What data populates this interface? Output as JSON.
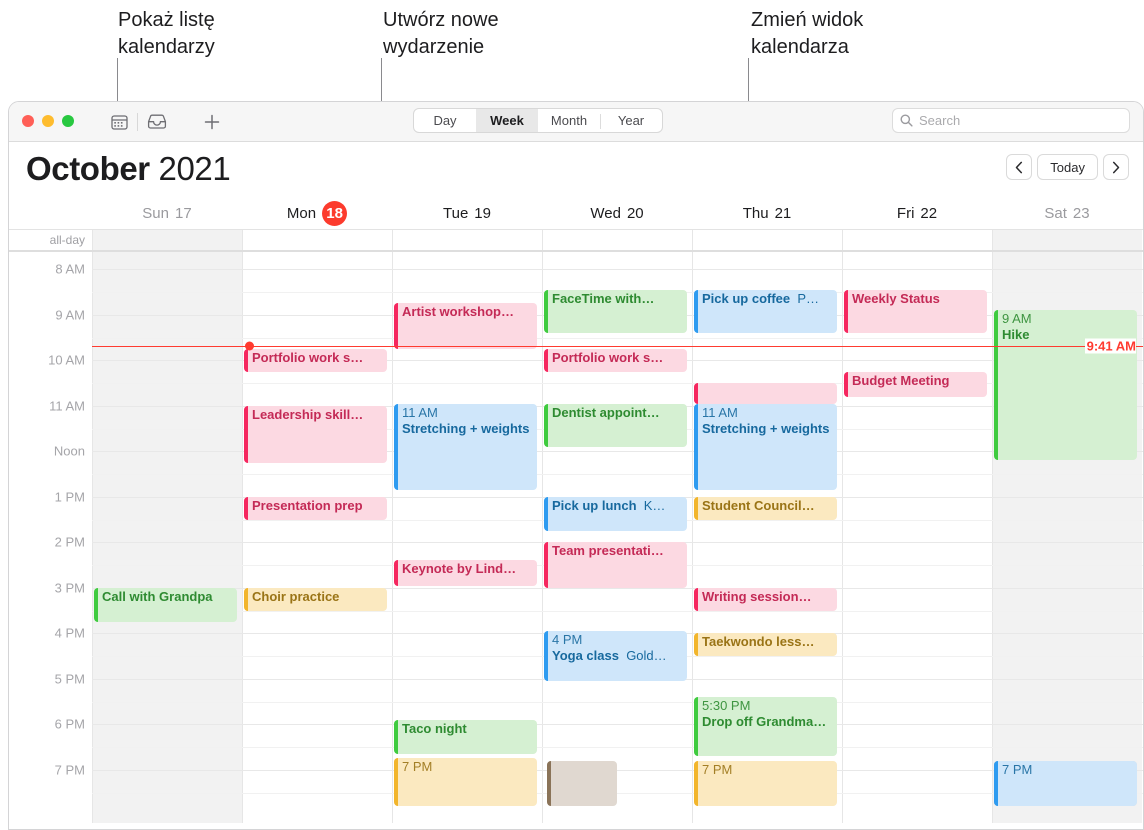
{
  "callouts": [
    {
      "id": "show-calendar-list",
      "text": "Pokaż listę\nkalendarzy"
    },
    {
      "id": "create-new-event",
      "text": "Utwórz nowe\nwydarzenie"
    },
    {
      "id": "change-calendar-view",
      "text": "Zmień widok\nkalendarza"
    }
  ],
  "toolbar": {
    "icons": [
      {
        "name": "calendar-sidebar-icon"
      },
      {
        "name": "inbox-icon"
      },
      {
        "name": "plus-icon"
      }
    ],
    "view_segments": [
      {
        "label": "Day",
        "active": false
      },
      {
        "label": "Week",
        "active": true
      },
      {
        "label": "Month",
        "active": false
      },
      {
        "label": "Year",
        "active": false
      }
    ],
    "search": {
      "placeholder": "Search",
      "value": ""
    }
  },
  "header": {
    "month": "October",
    "year": "2021",
    "nav": {
      "prev": "‹",
      "today": "Today",
      "next": "›"
    }
  },
  "grid": {
    "allday_label": "all-day",
    "days": [
      {
        "weekday": "Sun",
        "daynum": "17",
        "dim": true,
        "today": false,
        "weekend": true
      },
      {
        "weekday": "Mon",
        "daynum": "18",
        "dim": false,
        "today": true,
        "weekend": false
      },
      {
        "weekday": "Tue",
        "daynum": "19",
        "dim": false,
        "today": false,
        "weekend": false
      },
      {
        "weekday": "Wed",
        "daynum": "20",
        "dim": false,
        "today": false,
        "weekend": false
      },
      {
        "weekday": "Thu",
        "daynum": "21",
        "dim": false,
        "today": false,
        "weekend": false
      },
      {
        "weekday": "Fri",
        "daynum": "22",
        "dim": false,
        "today": false,
        "weekend": false
      },
      {
        "weekday": "Sat",
        "daynum": "23",
        "dim": true,
        "today": false,
        "weekend": true
      }
    ],
    "hours": [
      "8 AM",
      "9 AM",
      "10 AM",
      "11 AM",
      "Noon",
      "1 PM",
      "2 PM",
      "3 PM",
      "4 PM",
      "5 PM",
      "6 PM",
      "7 PM"
    ],
    "now": {
      "label": "9:41 AM",
      "color": "#ff3b30"
    }
  },
  "events": [
    {
      "day": 0,
      "title": "Call with Grandpa",
      "time": "",
      "location": "",
      "color": "green",
      "start": 15.0,
      "end": 15.75,
      "wrap": false
    },
    {
      "day": 1,
      "title": "Portfolio work s…",
      "time": "",
      "location": "",
      "color": "pink",
      "start": 9.75,
      "end": 10.25,
      "wrap": false
    },
    {
      "day": 1,
      "title": "Leadership skill…",
      "time": "",
      "location": "",
      "color": "pink",
      "start": 11.0,
      "end": 12.25,
      "wrap": false
    },
    {
      "day": 1,
      "title": "Presentation prep",
      "time": "",
      "location": "",
      "color": "pink",
      "start": 13.0,
      "end": 13.5,
      "wrap": false
    },
    {
      "day": 1,
      "title": "Choir practice",
      "time": "",
      "location": "",
      "color": "yellow",
      "start": 15.0,
      "end": 15.5,
      "wrap": false
    },
    {
      "day": 2,
      "title": "Artist workshop…",
      "time": "",
      "location": "",
      "color": "pink",
      "start": 8.75,
      "end": 9.75,
      "wrap": false
    },
    {
      "day": 2,
      "title": "Stretching + weights",
      "time": "11 AM",
      "location": "",
      "color": "blue",
      "start": 10.95,
      "end": 12.85,
      "wrap": true
    },
    {
      "day": 2,
      "title": "Keynote by Lind…",
      "time": "",
      "location": "",
      "color": "pink",
      "start": 14.4,
      "end": 14.95,
      "wrap": false
    },
    {
      "day": 2,
      "title": "Taco night",
      "time": "",
      "location": "",
      "color": "green",
      "start": 17.9,
      "end": 18.65,
      "wrap": false
    },
    {
      "day": 2,
      "title": "",
      "time": "7 PM",
      "location": "",
      "color": "yellow",
      "start": 18.75,
      "end": 19.8,
      "wrap": false
    },
    {
      "day": 3,
      "title": "FaceTime with…",
      "time": "",
      "location": "",
      "color": "green",
      "start": 8.45,
      "end": 9.4,
      "wrap": false
    },
    {
      "day": 3,
      "title": "Portfolio work s…",
      "time": "",
      "location": "",
      "color": "pink",
      "start": 9.75,
      "end": 10.25,
      "wrap": false
    },
    {
      "day": 3,
      "title": "Dentist appoint…",
      "time": "",
      "location": "",
      "color": "green",
      "start": 10.95,
      "end": 11.9,
      "wrap": false
    },
    {
      "day": 3,
      "title": "Pick up lunch",
      "time": "",
      "location": "K…",
      "color": "blue",
      "start": 13.0,
      "end": 13.75,
      "wrap": false
    },
    {
      "day": 3,
      "title": "Team presentati…",
      "time": "",
      "location": "",
      "color": "pink",
      "start": 14.0,
      "end": 15.0,
      "wrap": false
    },
    {
      "day": 3,
      "title": "Yoga class",
      "time": "4 PM",
      "location": "Gold…",
      "color": "blue",
      "start": 15.95,
      "end": 17.05,
      "wrap": false
    },
    {
      "day": 3,
      "title": "",
      "time": "",
      "location": "",
      "color": "brown",
      "start": 18.8,
      "end": 19.8,
      "wrap": false
    },
    {
      "day": 4,
      "title": "Pick up coffee",
      "time": "",
      "location": "P…",
      "color": "blue",
      "start": 8.45,
      "end": 9.4,
      "wrap": false
    },
    {
      "day": 4,
      "title": "",
      "time": "",
      "location": "",
      "color": "pink",
      "start": 10.5,
      "end": 10.95,
      "wrap": false
    },
    {
      "day": 4,
      "title": "Stretching + weights",
      "time": "11 AM",
      "location": "",
      "color": "blue",
      "start": 10.95,
      "end": 12.85,
      "wrap": true
    },
    {
      "day": 4,
      "title": "Student Council…",
      "time": "",
      "location": "",
      "color": "yellow",
      "start": 13.0,
      "end": 13.5,
      "wrap": false
    },
    {
      "day": 4,
      "title": "Writing session…",
      "time": "",
      "location": "",
      "color": "pink",
      "start": 15.0,
      "end": 15.5,
      "wrap": false
    },
    {
      "day": 4,
      "title": "Taekwondo less…",
      "time": "",
      "location": "",
      "color": "yellow",
      "start": 16.0,
      "end": 16.5,
      "wrap": false
    },
    {
      "day": 4,
      "title": "Drop off Grandma…",
      "time": "5:30 PM",
      "location": "",
      "color": "green",
      "start": 17.4,
      "end": 18.7,
      "wrap": true
    },
    {
      "day": 4,
      "title": "",
      "time": "7 PM",
      "location": "",
      "color": "yellow",
      "start": 18.8,
      "end": 19.8,
      "wrap": false
    },
    {
      "day": 5,
      "title": "Weekly Status",
      "time": "",
      "location": "",
      "color": "pink",
      "start": 8.45,
      "end": 9.4,
      "wrap": false
    },
    {
      "day": 5,
      "title": "Budget Meeting",
      "time": "",
      "location": "",
      "color": "pink",
      "start": 10.25,
      "end": 10.8,
      "wrap": false
    },
    {
      "day": 6,
      "title": "Hike",
      "time": "9 AM",
      "location": "",
      "color": "green",
      "start": 8.9,
      "end": 12.2,
      "wrap": false
    },
    {
      "day": 6,
      "title": "",
      "time": "7 PM",
      "location": "",
      "color": "brown",
      "start": 18.8,
      "end": 19.8,
      "wrap": false
    },
    {
      "day": 6,
      "title": "",
      "time": "7 PM",
      "location": "",
      "color": "blue",
      "start": 18.8,
      "end": 19.8,
      "wrap": false
    }
  ]
}
